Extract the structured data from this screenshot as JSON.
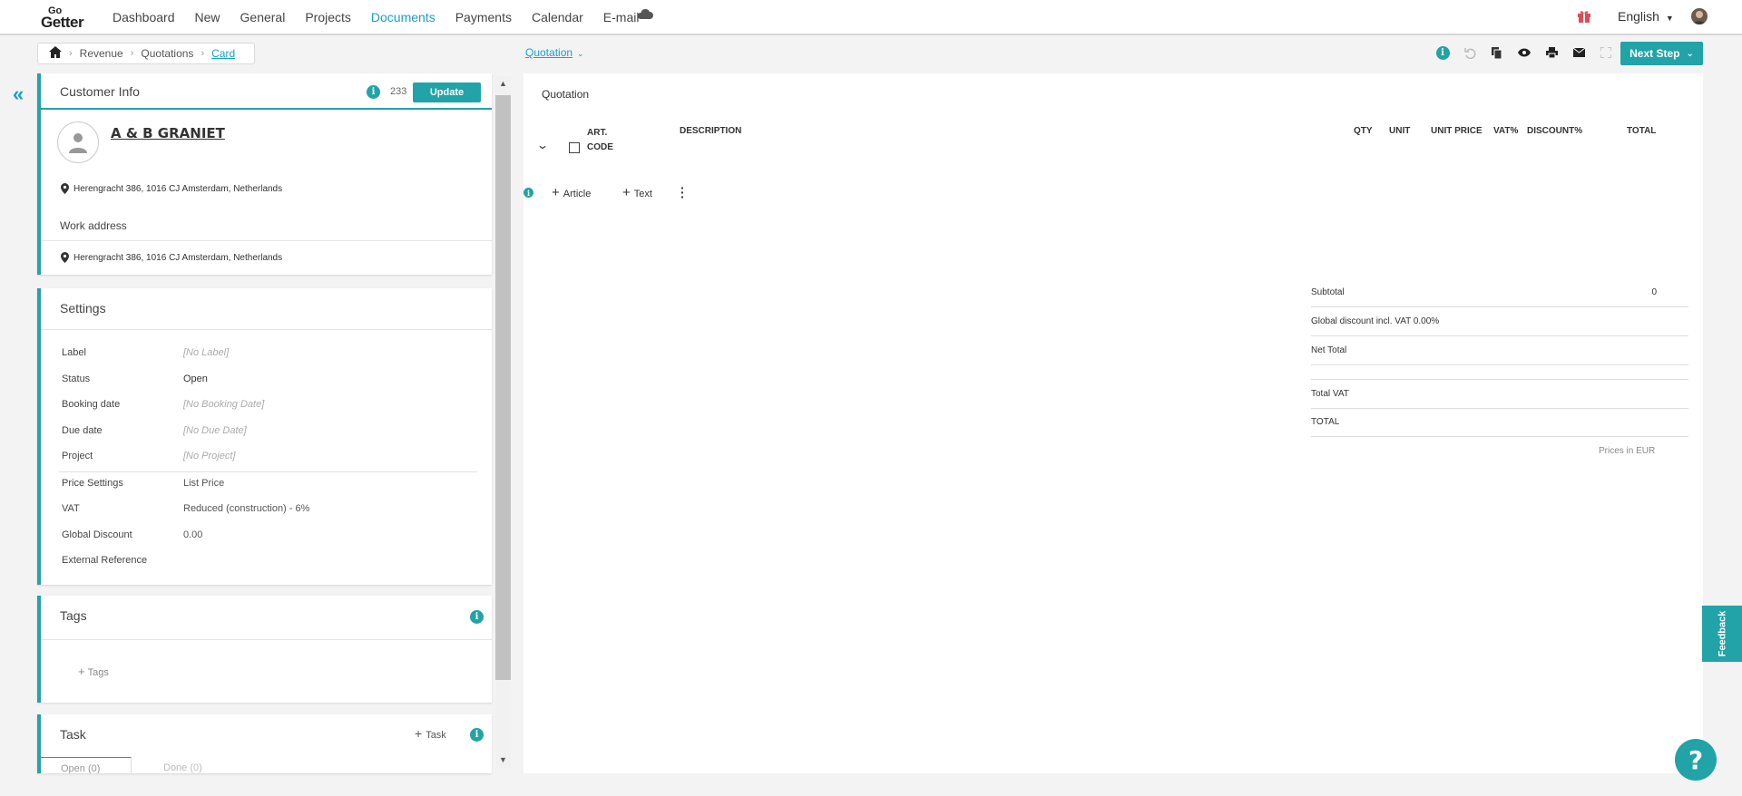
{
  "topnav": {
    "items": [
      "Dashboard",
      "New",
      "General",
      "Projects",
      "Documents",
      "Payments",
      "Calendar",
      "E-mail"
    ],
    "active_index": 4,
    "language": "English"
  },
  "breadcrumb": {
    "items": [
      "Revenue",
      "Quotations",
      "Card"
    ]
  },
  "document_type": "Quotation",
  "next_step_label": "Next Step",
  "customer": {
    "title": "Customer Info",
    "count": "233",
    "update_label": "Update",
    "name": "A & B GRANIET",
    "address": "Herengracht 386, 1016 CJ Amsterdam, Netherlands",
    "work_address_label": "Work address",
    "work_address": "Herengracht 386, 1016 CJ Amsterdam, Netherlands"
  },
  "settings": {
    "title": "Settings",
    "rows": [
      {
        "label": "Label",
        "value": "[No Label]",
        "placeholder": true
      },
      {
        "label": "Status",
        "value": "Open",
        "placeholder": false
      },
      {
        "label": "Booking date",
        "value": "[No Booking Date]",
        "placeholder": true
      },
      {
        "label": "Due date",
        "value": "[No Due Date]",
        "placeholder": true
      },
      {
        "label": "Project",
        "value": "[No Project]",
        "placeholder": true
      },
      {
        "label": "Price Settings",
        "value": "List Price",
        "placeholder": false
      },
      {
        "label": "VAT",
        "value": "Reduced (construction) - 6%",
        "placeholder": false
      },
      {
        "label": "Global Discount",
        "value": "0.00",
        "placeholder": false
      },
      {
        "label": "External Reference",
        "value": "",
        "placeholder": false
      }
    ]
  },
  "tags": {
    "title": "Tags",
    "add_label": "Tags"
  },
  "task": {
    "title": "Task",
    "add_label": "Task",
    "tab_open": "Open (0)",
    "tab_done": "Done (0)"
  },
  "quotation": {
    "title": "Quotation",
    "columns": {
      "art_code_1": "ART.",
      "art_code_2": "CODE",
      "description": "DESCRIPTION",
      "qty": "QTY",
      "unit": "UNIT",
      "unit_price": "UNIT PRICE",
      "vat": "VAT%",
      "discount": "DISCOUNT%",
      "total": "TOTAL"
    },
    "add_article": "Article",
    "add_text": "Text",
    "summary": {
      "subtotal_label": "Subtotal",
      "subtotal_value": "0",
      "global_discount_label": "Global discount incl. VAT 0.00%",
      "net_total_label": "Net Total",
      "total_vat_label": "Total VAT",
      "total_label": "TOTAL",
      "currency_note": "Prices in EUR"
    }
  },
  "feedback_label": "Feedback",
  "help_label": "?",
  "colors": {
    "accent": "#21a3a8",
    "link": "#1a9fc8"
  }
}
